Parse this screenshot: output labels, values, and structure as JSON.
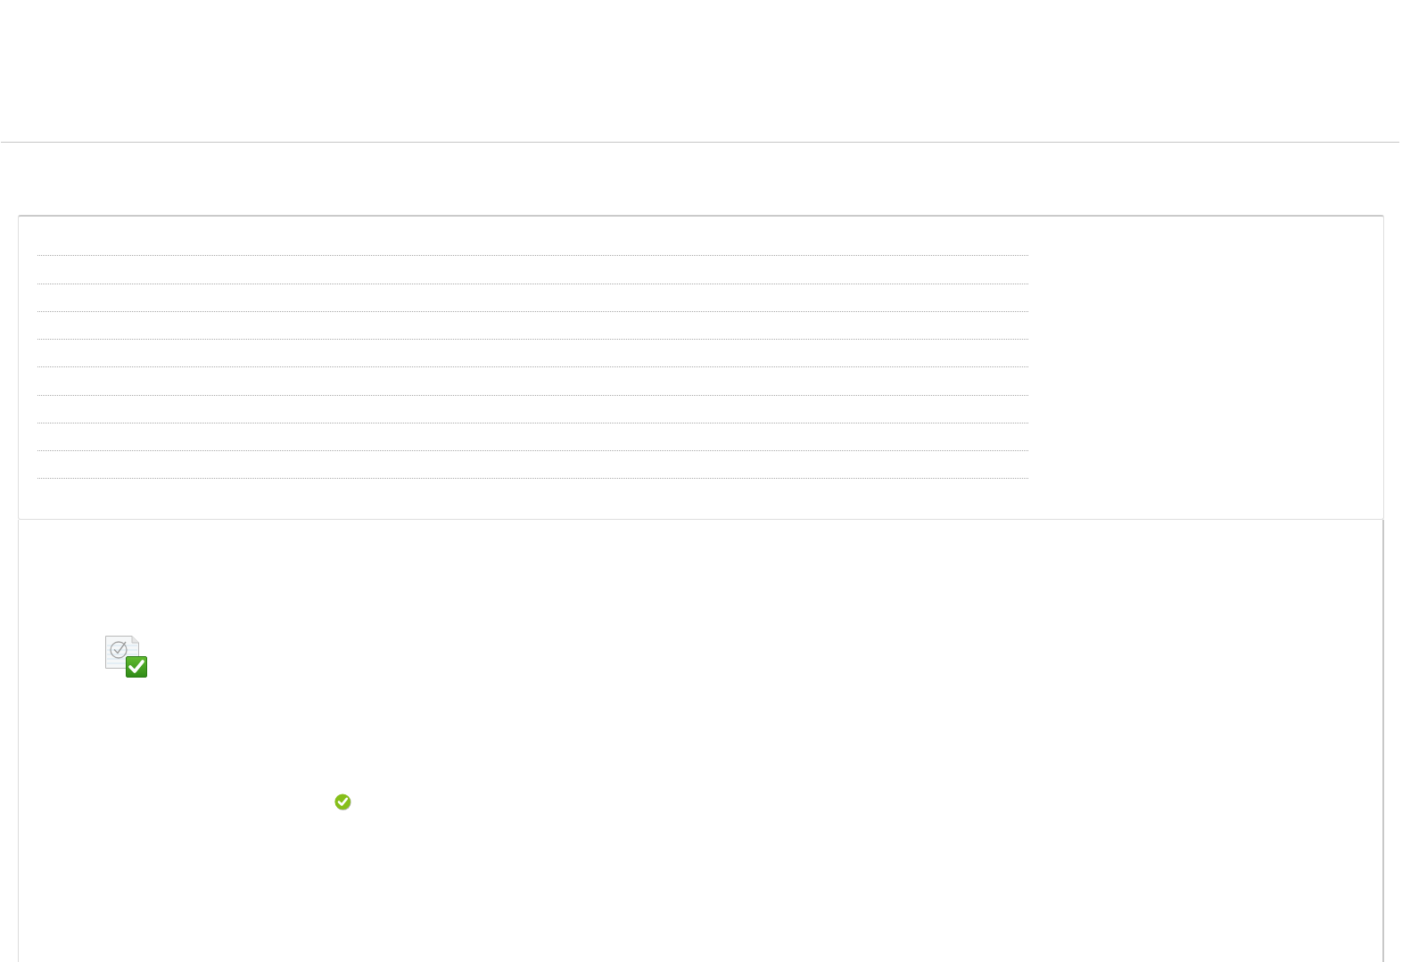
{
  "list_panel": {
    "rows": [
      {
        "kind": "dotted"
      },
      {
        "kind": "dotted"
      },
      {
        "kind": "dotted"
      },
      {
        "kind": "dotted"
      },
      {
        "kind": "dotted"
      },
      {
        "kind": "dotted"
      },
      {
        "kind": "dotted"
      },
      {
        "kind": "dotted"
      },
      {
        "kind": "dotted"
      }
    ]
  },
  "result_panel": {
    "document": {
      "verified": true
    },
    "status_mark": {
      "passed": true
    }
  }
}
